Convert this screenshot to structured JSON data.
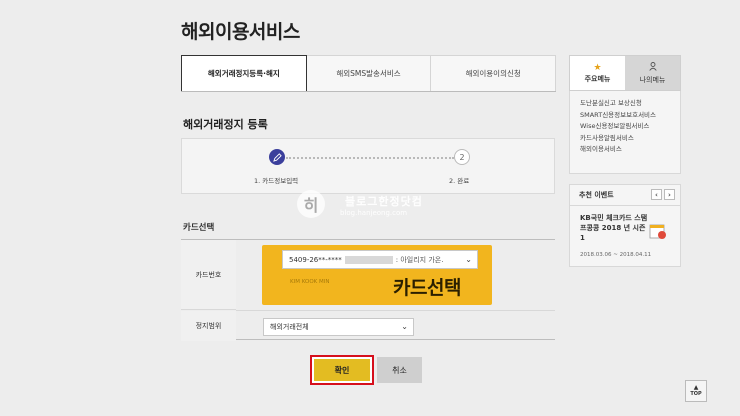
{
  "page": {
    "title": "해외이용서비스"
  },
  "tabs": [
    {
      "label": "해외거래정지등록·해지",
      "active": true
    },
    {
      "label": "해외SMS발송서비스",
      "active": false
    },
    {
      "label": "해외이용이의신청",
      "active": false
    }
  ],
  "section": {
    "title": "해외거래정지 등록"
  },
  "steps": [
    {
      "label": "1. 카드정보입력",
      "icon": "pencil-icon",
      "status": "current"
    },
    {
      "label": "2. 완료",
      "number": "2",
      "status": "pending"
    }
  ],
  "watermark": {
    "logo_char": "히",
    "line1": "블로그한정닷컴",
    "line2": "blog.hanjeong.com"
  },
  "card_section": {
    "title": "카드선택",
    "card_number_label": "카드번호",
    "card_number_prefix": "5409-26**-****",
    "card_desc": ": 아일리지 가온.",
    "card_brand": "KIM KOOK MIN",
    "card_select_caption": "카드선택",
    "scope_label": "정지범위",
    "scope_value": "해외거래전체"
  },
  "buttons": {
    "confirm": "확인",
    "cancel": "취소"
  },
  "sidebar": {
    "tabs": [
      {
        "label": "주요메뉴",
        "icon": "star-icon",
        "active": true
      },
      {
        "label": "나의메뉴",
        "icon": "person-icon",
        "active": false
      }
    ],
    "menu": [
      "도난분실신고 보상신청",
      "SMART신용정보보호서비스",
      "Wise신용정보알림서비스",
      "카드사용알림서비스",
      "해외이용서비스"
    ],
    "event": {
      "heading": "추천 이벤트",
      "title": "KB국민 체크카드 스탬프콩콩 2018 년 시즌 1",
      "date": "2018.03.06 ~ 2018.04.11"
    }
  },
  "top_button": {
    "label": "TOP"
  },
  "colors": {
    "accent_yellow": "#f2b51e",
    "confirm_border": "#d60f1c",
    "step_active": "#3b3f9c"
  }
}
